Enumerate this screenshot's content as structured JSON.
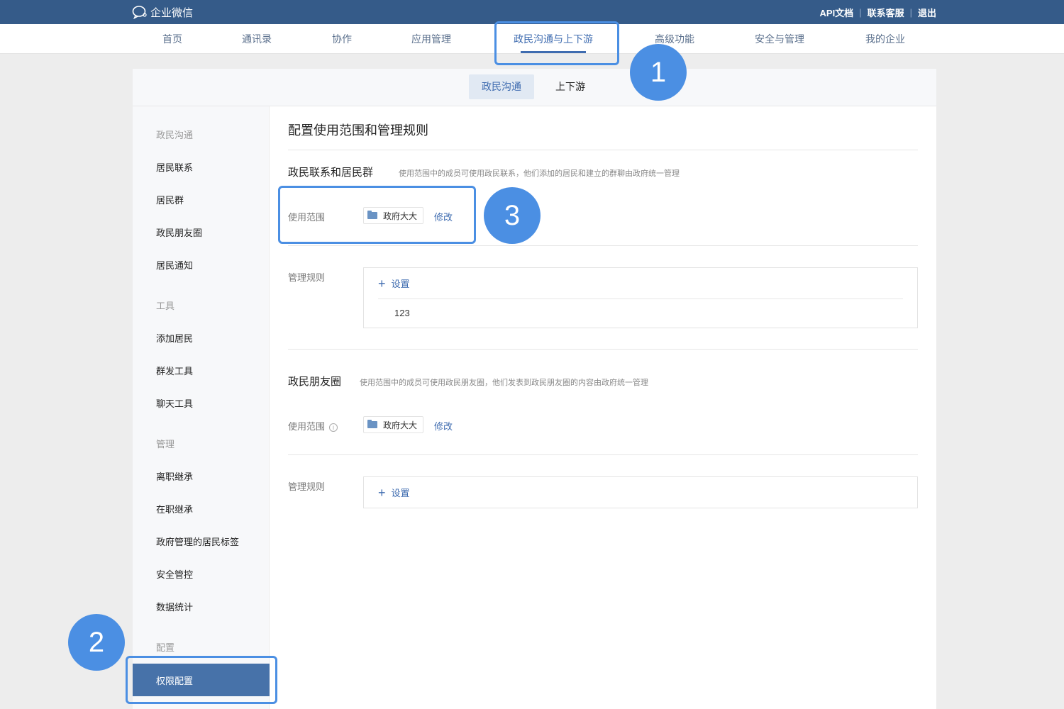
{
  "header": {
    "logo_text": "企业微信",
    "links": [
      "API文档",
      "联系客服",
      "退出"
    ]
  },
  "nav": {
    "items": [
      "首页",
      "通讯录",
      "协作",
      "应用管理",
      "政民沟通与上下游",
      "高级功能",
      "安全与管理",
      "我的企业"
    ],
    "active_index": 4
  },
  "subtabs": {
    "items": [
      "政民沟通",
      "上下游"
    ],
    "active_index": 0
  },
  "sidebar": {
    "groups": [
      {
        "heading": "政民沟通",
        "items": [
          "居民联系",
          "居民群",
          "政民朋友圈",
          "居民通知"
        ]
      },
      {
        "heading": "工具",
        "items": [
          "添加居民",
          "群发工具",
          "聊天工具"
        ]
      },
      {
        "heading": "管理",
        "items": [
          "离职继承",
          "在职继承",
          "政府管理的居民标签",
          "安全管控",
          "数据统计"
        ]
      },
      {
        "heading": "配置",
        "items": [
          "权限配置"
        ]
      }
    ],
    "active_item": "权限配置"
  },
  "content": {
    "title": "配置使用范围和管理规则",
    "section1": {
      "title": "政民联系和居民群",
      "desc": "使用范围中的成员可使用政民联系，他们添加的居民和建立的群聊由政府统一管理",
      "scope_label": "使用范围",
      "scope_tag": "政府大大",
      "modify_label": "修改",
      "rule_label": "管理规则",
      "rule_add_label": "设置",
      "rule_value": "123"
    },
    "section2": {
      "title": "政民朋友圈",
      "desc": "使用范围中的成员可使用政民朋友圈，他们发表到政民朋友圈的内容由政府统一管理",
      "scope_label": "使用范围",
      "info_icon": "i",
      "scope_tag": "政府大大",
      "modify_label": "修改",
      "rule_label": "管理规则",
      "rule_add_label": "设置"
    }
  },
  "annotations": {
    "badge1": "1",
    "badge2": "2",
    "badge3": "3",
    "accent_color": "#4b8fe3"
  }
}
